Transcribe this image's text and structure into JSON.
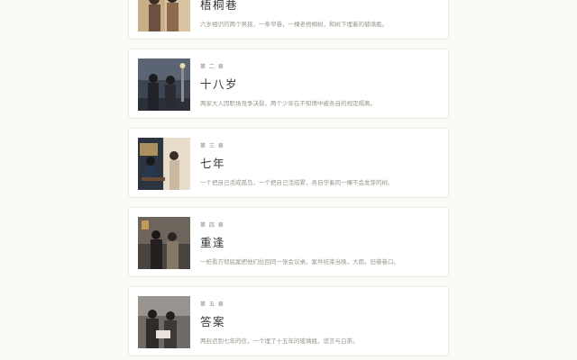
{
  "chapters": [
    {
      "number": "",
      "title": "梧桐巷",
      "desc": "六岁相识的两个男孩，一条窄巷，一棵老梧桐树，和树下埋着的玻璃瓶。",
      "image": "two-boys-in-alley-illustration"
    },
    {
      "number": "第 二 章",
      "title": "十八岁",
      "desc": "两家大人因职场竞争决裂，两个少年在不知情中被各自的规定隔离。",
      "image": "two-young-men-at-night-illustration"
    },
    {
      "number": "第 三 章",
      "title": "七年",
      "desc": "一个把自己活成孤岛，一个把自己活成雾，各自守着同一棵不会发芽的树。",
      "image": "two-men-at-cafe-illustration"
    },
    {
      "number": "第 四 章",
      "title": "重逢",
      "desc": "一桩看方彻底案把他们拉回同一张会议桌。案件结束当晚，大雨，旧巷巷口。",
      "image": "two-men-reunion-rain-illustration"
    },
    {
      "number": "第 五 章",
      "title": "答案",
      "desc": "两封迟到七年的信，一个埋了十五年的玻璃瓶，谎言与白茶。",
      "image": "two-men-reading-letters-illustration"
    }
  ]
}
